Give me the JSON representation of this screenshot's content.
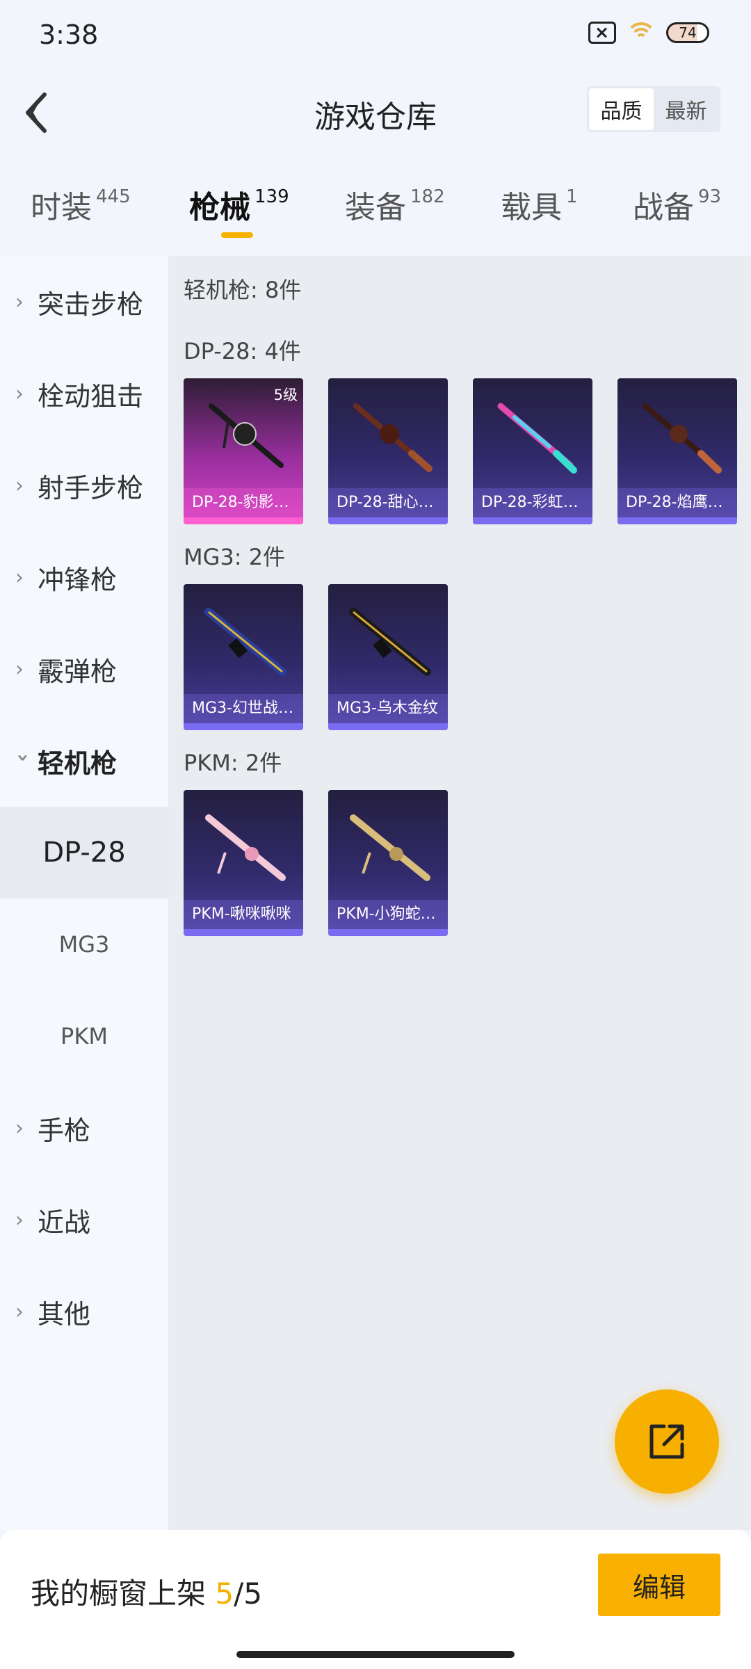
{
  "status": {
    "time": "3:38",
    "battery": "74"
  },
  "header": {
    "title": "游戏仓库",
    "sort_quality": "品质",
    "sort_latest": "最新"
  },
  "tabs": [
    {
      "label": "时装",
      "count": "445"
    },
    {
      "label": "枪械",
      "count": "139"
    },
    {
      "label": "装备",
      "count": "182"
    },
    {
      "label": "载具",
      "count": "1"
    },
    {
      "label": "战备",
      "count": "93"
    }
  ],
  "sidebar": {
    "categories": [
      "突击步枪",
      "栓动狙击",
      "射手步枪",
      "冲锋枪",
      "霰弹枪",
      "轻机枪"
    ],
    "subs": [
      "DP-28",
      "MG3",
      "PKM"
    ],
    "more": [
      "手枪",
      "近战",
      "其他"
    ]
  },
  "content": {
    "summary": "轻机枪: 8件",
    "groups": [
      {
        "title": "DP-28: 4件",
        "items": [
          {
            "name": "DP-28-豹影…",
            "level": "5级"
          },
          {
            "name": "DP-28-甜心…"
          },
          {
            "name": "DP-28-彩虹…"
          },
          {
            "name": "DP-28-焰鹰…"
          }
        ]
      },
      {
        "title": "MG3: 2件",
        "items": [
          {
            "name": "MG3-幻世战…"
          },
          {
            "name": "MG3-乌木金纹"
          }
        ]
      },
      {
        "title": "PKM: 2件",
        "items": [
          {
            "name": "PKM-啾咪啾咪"
          },
          {
            "name": "PKM-小狗蛇…"
          }
        ]
      }
    ]
  },
  "bottom": {
    "shelf_label": "我的橱窗上架",
    "shelf_current": "5",
    "shelf_total": "/5",
    "edit_label": "编辑"
  },
  "colors": {
    "accent": "#f9b000",
    "card_purple": "#4a3f98",
    "card_pink": "#d443c2"
  }
}
